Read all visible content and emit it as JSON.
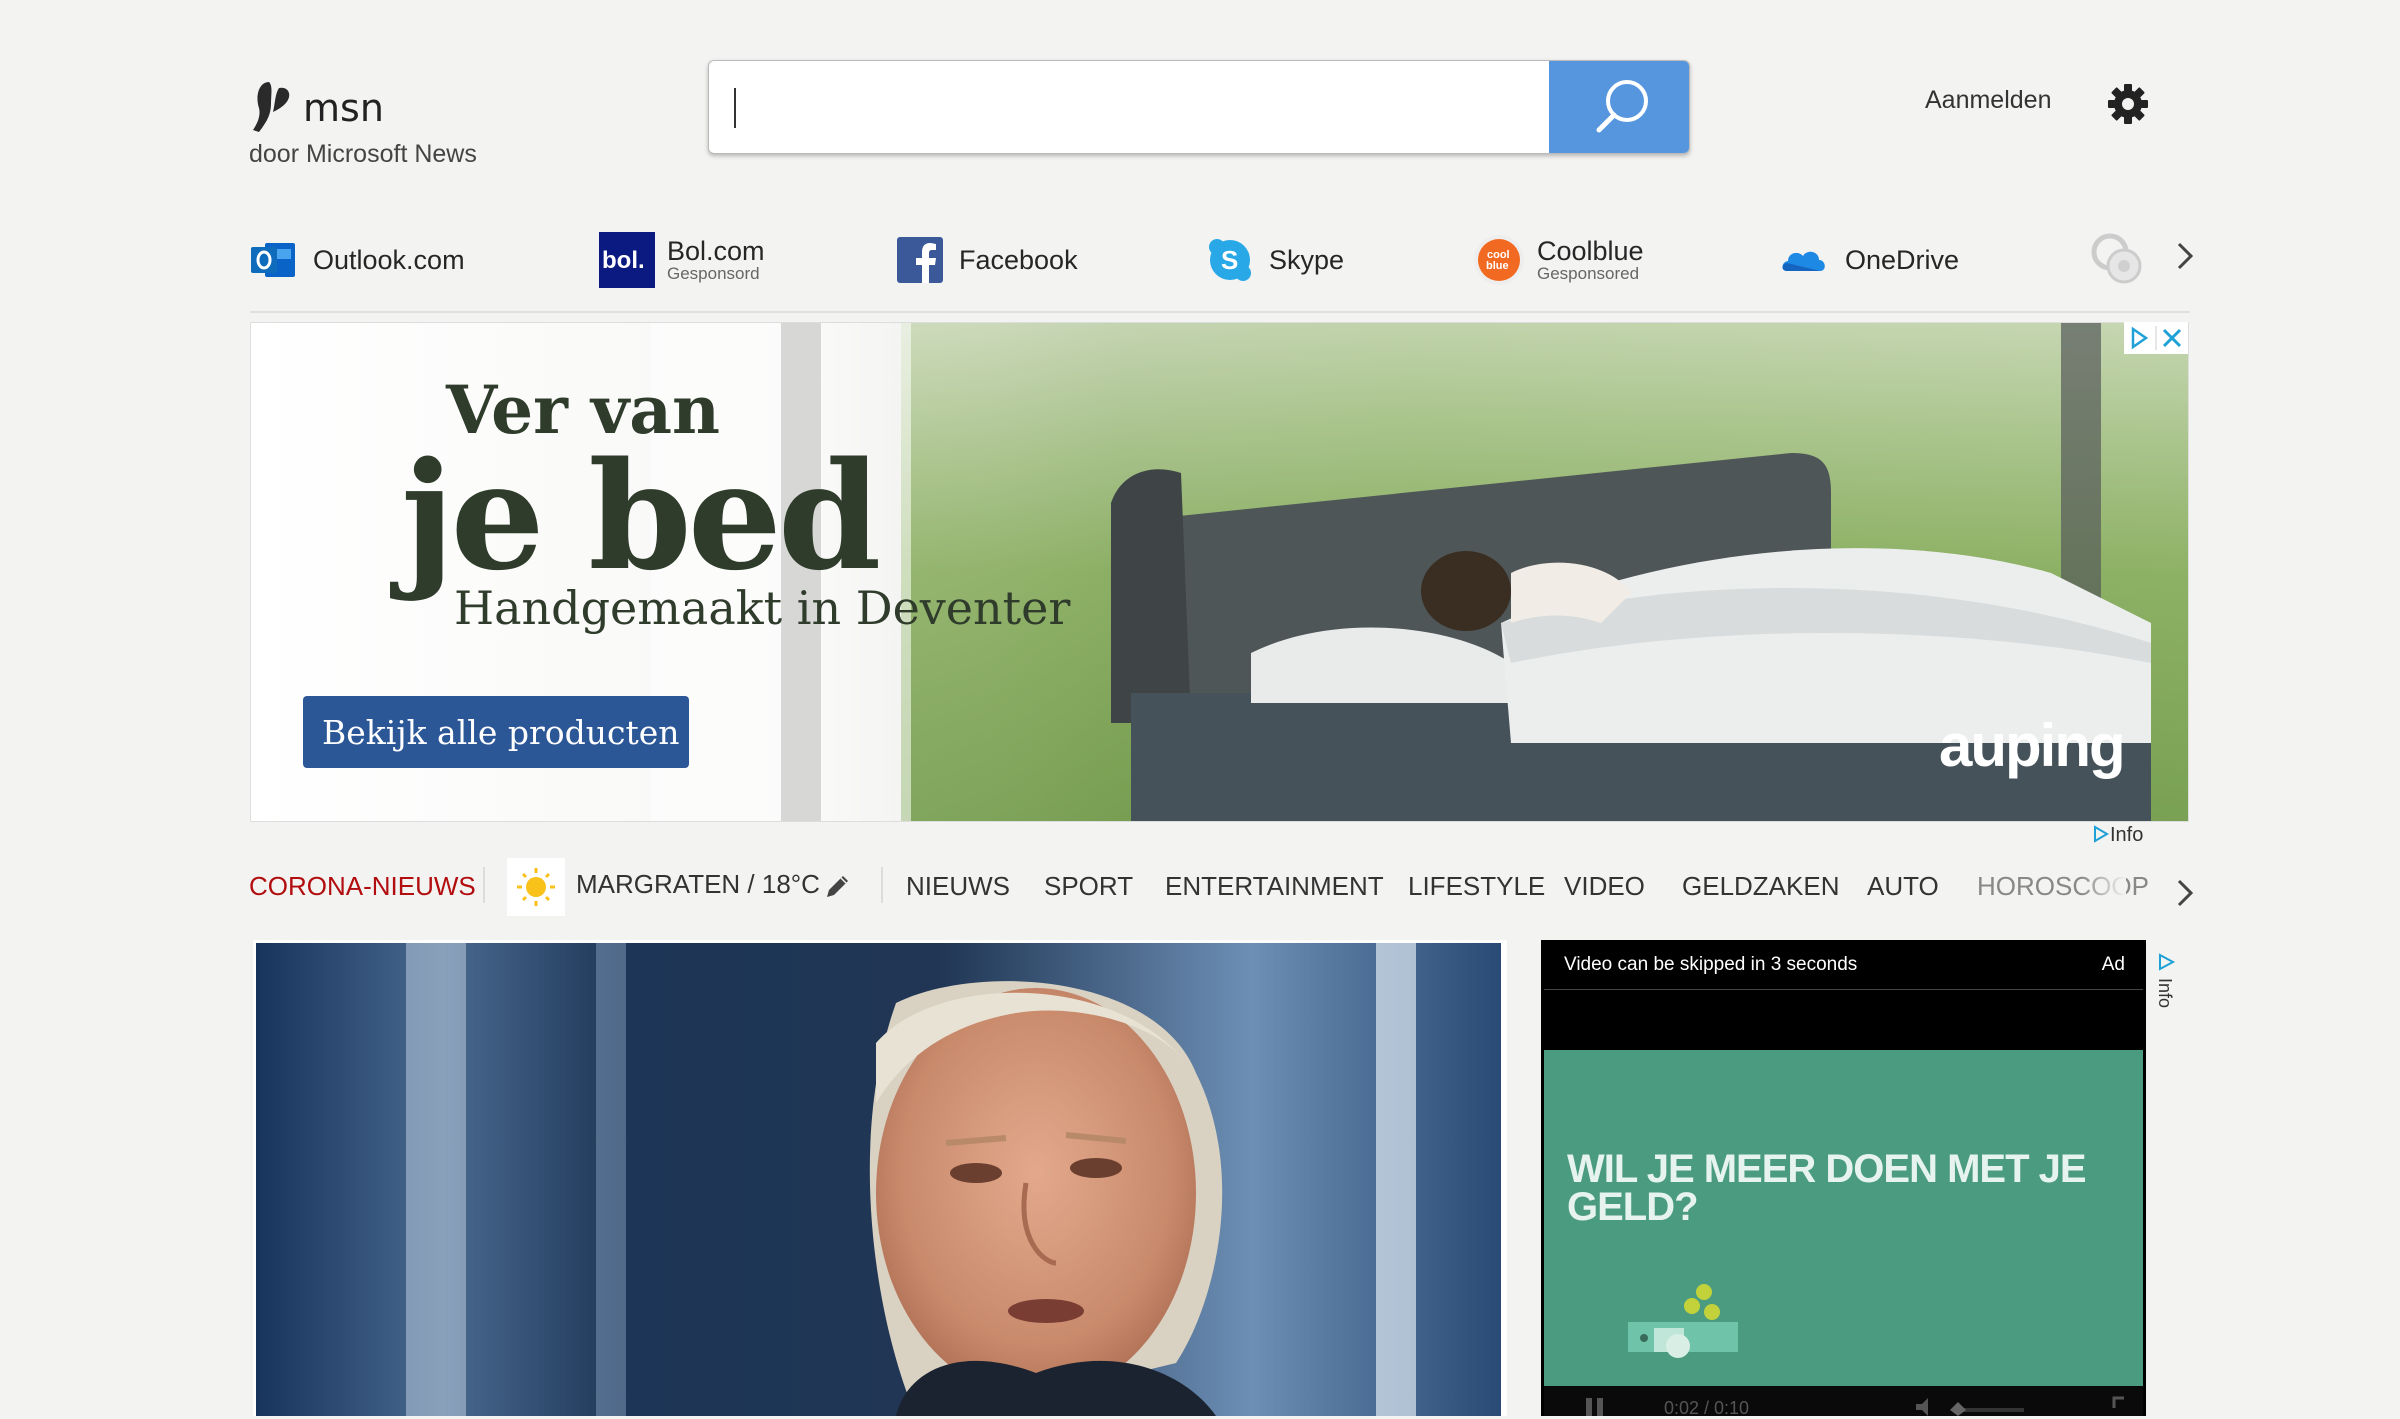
{
  "header": {
    "brand": "msn",
    "tagline": "door Microsoft News",
    "search": {
      "value": "",
      "placeholder": ""
    },
    "signin_label": "Aanmelden"
  },
  "quicklinks": [
    {
      "label": "Outlook.com",
      "sponsored": "",
      "icon": "outlook-icon"
    },
    {
      "label": "Bol.com",
      "sponsored": "Gesponsord",
      "icon": "bol-icon"
    },
    {
      "label": "Facebook",
      "sponsored": "",
      "icon": "facebook-icon"
    },
    {
      "label": "Skype",
      "sponsored": "",
      "icon": "skype-icon"
    },
    {
      "label": "Coolblue",
      "sponsored": "Gesponsored",
      "icon": "coolblue-icon"
    },
    {
      "label": "OneDrive",
      "sponsored": "",
      "icon": "onedrive-icon"
    }
  ],
  "banner_ad": {
    "line1": "Ver van",
    "line2": "je bed",
    "line3": "Handgemaakt in Deventer",
    "cta": "Bekijk alle producten",
    "brand": "auping",
    "info": "Info"
  },
  "nav": {
    "corona": "CORONA-NIEUWS",
    "weather": "MARGRATEN / 18°C",
    "items": [
      "NIEUWS",
      "SPORT",
      "ENTERTAINMENT",
      "LIFESTYLE",
      "VIDEO",
      "GELDZAKEN",
      "AUTO",
      "HOROSCOOP"
    ]
  },
  "video_ad": {
    "skip_text": "Video can be skipped in 3 seconds",
    "ad_label": "Ad",
    "headline": "WIL JE MEER DOEN MET JE GELD?",
    "time": "0:02  /  0:10",
    "info": "Info"
  },
  "colors": {
    "accent": "#5596de",
    "corona": "#b20e10",
    "cta": "#2c5797",
    "video_green": "#4a9b80"
  }
}
